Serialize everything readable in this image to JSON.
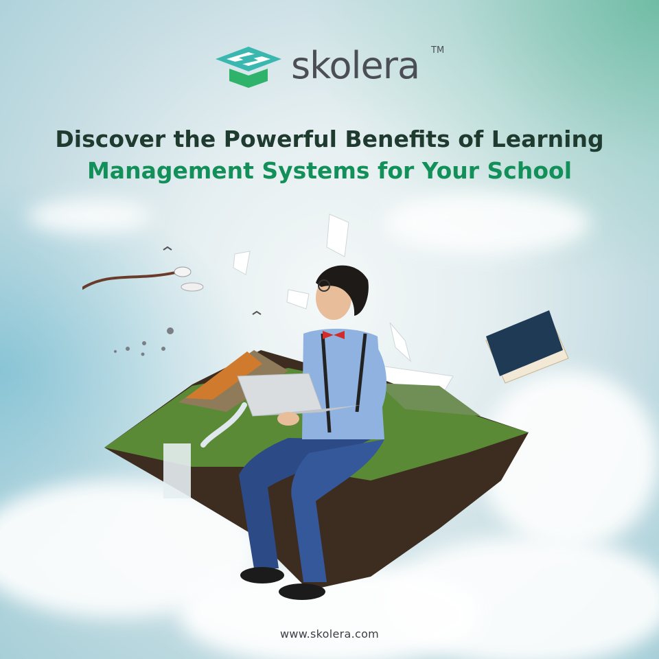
{
  "brand": {
    "name": "skolera",
    "trademark": "TM",
    "icon": "graduation-cap-s-logo",
    "colors": {
      "teal": "#3ab8b0",
      "green": "#2fb36b",
      "text": "#4b4f55"
    }
  },
  "headline": {
    "line1": "Discover the Powerful Benefits of Learning",
    "line2": "Management Systems for Your School",
    "colors": {
      "line1": "#1f3a2e",
      "line2": "#13905a"
    }
  },
  "illustration": {
    "subject": "student-with-laptop-on-floating-island-icon"
  },
  "footer": {
    "url": "www.skolera.com"
  }
}
